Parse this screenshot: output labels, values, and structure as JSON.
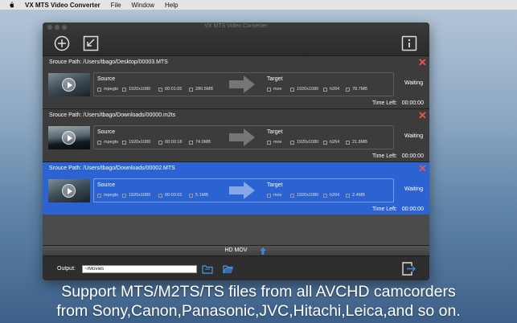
{
  "menubar": {
    "app": "VX MTS Video Converter",
    "items": [
      "File",
      "Window",
      "Help"
    ]
  },
  "window": {
    "title": "VX MTS Video Converter"
  },
  "items": [
    {
      "path": "Srouce Path:  /Users/tbago/Desktop/00003.MTS",
      "source_label": "Source",
      "target_label": "Target",
      "src_codec": "mpegts",
      "src_res": "1920x1080",
      "src_dur": "00:01:05",
      "src_size": "280.5MB",
      "tgt_codec": "mov",
      "tgt_res": "1920x1080",
      "tgt_vcodec": "h264",
      "tgt_size": "78.7MB",
      "status": "Waiting",
      "time_left_label": "Time Left:",
      "time_left": "00:00:00"
    },
    {
      "path": "Srouce Path:  /Users/tbago/Downloads/00000.m2ts",
      "source_label": "Source",
      "target_label": "Target",
      "src_codec": "mpegts",
      "src_res": "1920x1080",
      "src_dur": "00:00:18",
      "src_size": "74.0MB",
      "tgt_codec": "mov",
      "tgt_res": "1920x1080",
      "tgt_vcodec": "h264",
      "tgt_size": "21.8MB",
      "status": "Waiting",
      "time_left_label": "Time Left:",
      "time_left": "00:00:00"
    },
    {
      "path": "Srouce Path:  /Users/tbago/Downloads/00002.MTS",
      "source_label": "Source",
      "target_label": "Target",
      "src_codec": "mpegts",
      "src_res": "1920x1080",
      "src_dur": "00:00:02",
      "src_size": "5.1MB",
      "tgt_codec": "mov",
      "tgt_res": "1920x1080",
      "tgt_vcodec": "h264",
      "tgt_size": "2.4MB",
      "status": "Waiting",
      "time_left_label": "Time Left:",
      "time_left": "00:00:00"
    }
  ],
  "format": {
    "label": "HD MOV"
  },
  "output": {
    "label": "Output:",
    "path": "~/Movies"
  },
  "caption": {
    "line1": "Support MTS/M2TS/TS files from all AVCHD camcorders",
    "line2": "from Sony,Canon,Panasonic,JVC,Hitachi,Leica,and so on."
  },
  "colors": {
    "selected_row": "#2b63d3",
    "remove_icon": "#e25b46",
    "accent_blue": "#3a8be8"
  }
}
